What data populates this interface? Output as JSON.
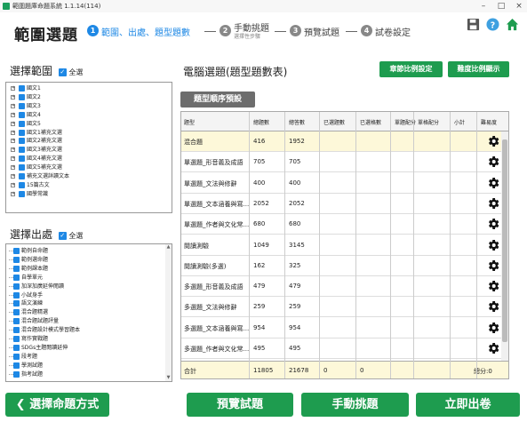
{
  "window": {
    "title": "範圍題庫命題系統 1.1.14(114)"
  },
  "header": {
    "page_title": "範圍選題",
    "steps": [
      {
        "num": "1",
        "label": "範圍、出處、題型題數",
        "sub": ""
      },
      {
        "num": "2",
        "label": "手動挑題",
        "sub": "選擇性步驟"
      },
      {
        "num": "3",
        "label": "預覽試題",
        "sub": ""
      },
      {
        "num": "4",
        "label": "試卷設定",
        "sub": ""
      }
    ]
  },
  "left": {
    "range_title": "選擇範圍",
    "select_all_label": "全選",
    "range_items": [
      "國文1",
      "國文2",
      "國文3",
      "國文4",
      "國文5",
      "國文1補充文選",
      "國文2補充文選",
      "國文3補充文選",
      "國文4補充文選",
      "國文5補充文選",
      "補充文選詳讀文本",
      "15篇古文",
      "國學常識"
    ],
    "source_title": "選擇出處",
    "source_select_all_label": "全選",
    "source_items": [
      "範例自命題",
      "範例選命題",
      "範例課本題",
      "自學單元",
      "加深加廣延伸閱讀",
      "小試身手",
      "語文演練",
      "混合題精選",
      "混合題試題評量",
      "混合題設計模式學習題本",
      "寫作實戰題",
      "SDGs主題閱讀延伸",
      "段考題",
      "學測試題",
      "指考試題"
    ]
  },
  "right": {
    "title": "電腦選題(題型題數表)",
    "btn_chapter_ratio": "章節比例設定",
    "btn_difficulty_ratio": "難度比例顯示",
    "btn_type_order": "題型順序預設",
    "columns": [
      "題型",
      "總題數",
      "總答數",
      "已選題數",
      "已選格數",
      "單題配分",
      "單格配分",
      "小計",
      "難易度"
    ],
    "rows": [
      {
        "type": "混合題",
        "total": "416",
        "answers": "1952",
        "highlight": true
      },
      {
        "type": "單選題_形音義及成語",
        "total": "705",
        "answers": "705",
        "highlight": false
      },
      {
        "type": "單選題_文法與修辭",
        "total": "400",
        "answers": "400",
        "highlight": false
      },
      {
        "type": "單選題_文本涵養與寫...",
        "total": "2052",
        "answers": "2052",
        "highlight": false
      },
      {
        "type": "單選題_作者與文化常...",
        "total": "680",
        "answers": "680",
        "highlight": false
      },
      {
        "type": "閱讀測驗",
        "total": "1049",
        "answers": "3145",
        "highlight": false
      },
      {
        "type": "閱讀測驗(多選)",
        "total": "162",
        "answers": "325",
        "highlight": false
      },
      {
        "type": "多選題_形音義及成語",
        "total": "479",
        "answers": "479",
        "highlight": false
      },
      {
        "type": "多選題_文法與修辭",
        "total": "259",
        "answers": "259",
        "highlight": false
      },
      {
        "type": "多選題_文本涵養與寫...",
        "total": "954",
        "answers": "954",
        "highlight": false
      },
      {
        "type": "多選題_作者與文化常...",
        "total": "495",
        "answers": "495",
        "highlight": false
      }
    ],
    "totals": {
      "label": "合計",
      "total": "11805",
      "answers": "21678",
      "picked": "0",
      "picked_cells": "0",
      "score": "總分:0"
    }
  },
  "footer": {
    "back_label": "選擇命題方式",
    "preview_label": "預覽試題",
    "manual_label": "手動挑題",
    "publish_label": "立即出卷"
  },
  "colors": {
    "accent": "#1e9c4f",
    "step_active": "#1e88e5",
    "highlight_row": "#fdf8d9"
  }
}
